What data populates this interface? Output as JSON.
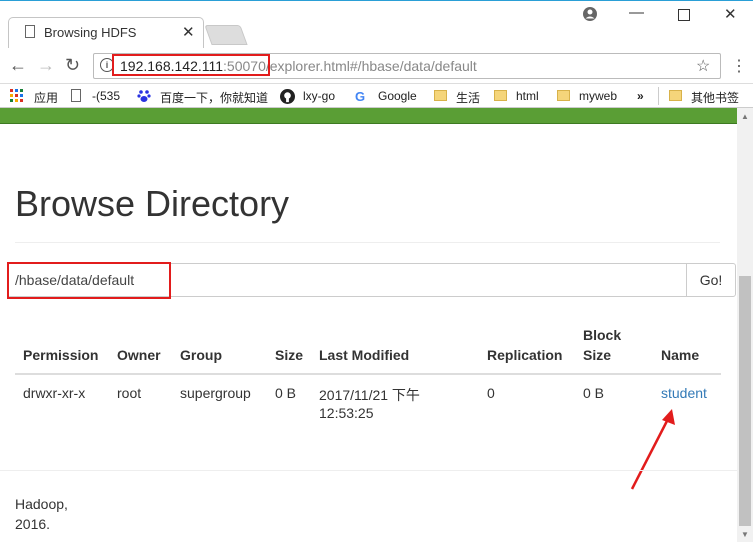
{
  "browser": {
    "tab_title": "Browsing HDFS",
    "url_host": "192.168.142.111",
    "url_port": ":50070",
    "url_path": "/explorer.html#/hbase/data/default",
    "bookmarks": [
      "应用",
      "-(535",
      "百度一下，你就知道",
      "lxy-go",
      "Google",
      "生活",
      "html",
      "myweb",
      "»",
      "其他书签"
    ]
  },
  "page": {
    "heading": "Browse Directory",
    "path_value": "/hbase/data/default",
    "go_label": "Go!",
    "table": {
      "headers": {
        "permission": "Permission",
        "owner": "Owner",
        "group": "Group",
        "size": "Size",
        "last_modified": "Last Modified",
        "replication": "Replication",
        "block_size_1": "Block",
        "block_size_2": "Size",
        "name": "Name"
      },
      "rows": [
        {
          "permission": "drwxr-xr-x",
          "owner": "root",
          "group": "supergroup",
          "size": "0 B",
          "last_modified_1": "2017/11/21 下午",
          "last_modified_2": "12:53:25",
          "replication": "0",
          "block_size": "0 B",
          "name": "student"
        }
      ]
    },
    "footer_1": "Hadoop,",
    "footer_2": "2016."
  },
  "colors": {
    "accent_green": "#5a9e35",
    "link": "#337ab7",
    "annotation_red": "#e21c1c"
  }
}
